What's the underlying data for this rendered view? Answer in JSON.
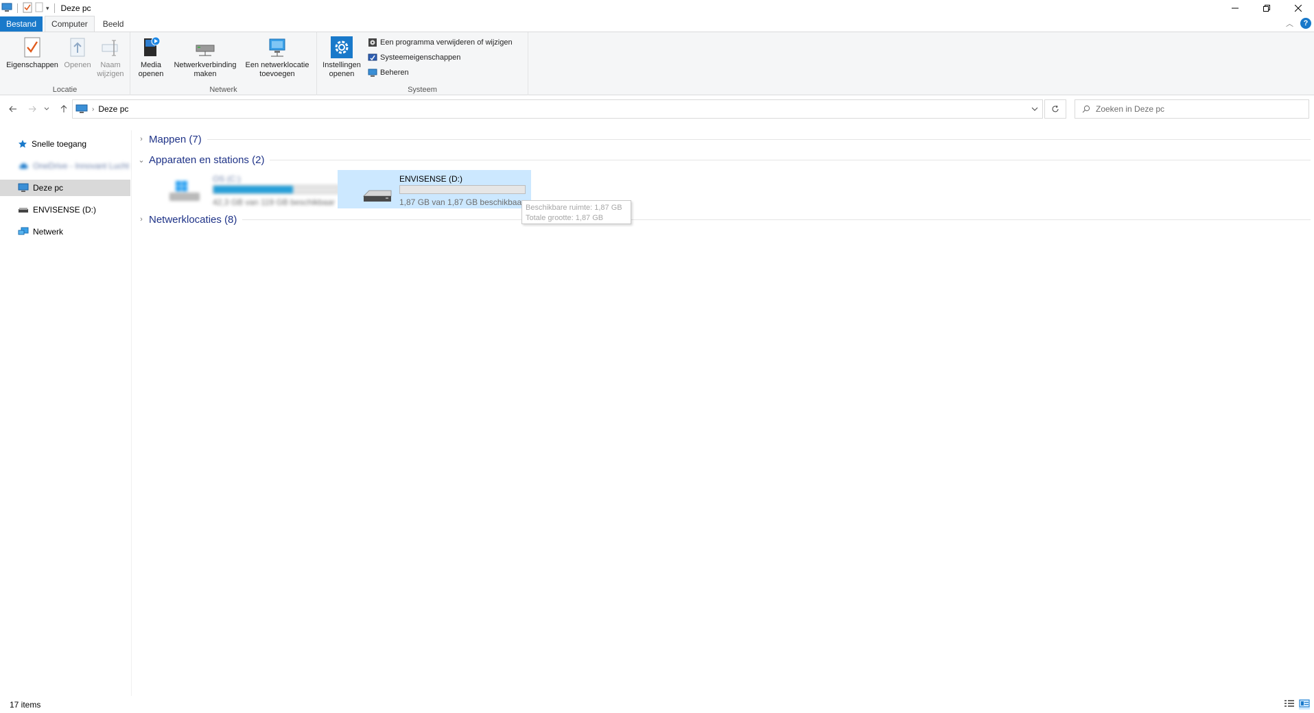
{
  "window": {
    "title": "Deze pc",
    "ribbon_tabs": [
      "Bestand",
      "Computer",
      "Beeld"
    ],
    "active_tab": "Computer"
  },
  "ribbon": {
    "groups": {
      "locatie": "Locatie",
      "netwerk": "Netwerk",
      "systeem": "Systeem"
    },
    "buttons": {
      "eigenschappen": "Eigenschappen",
      "openen": "Openen",
      "naam_line1": "Naam",
      "naam_line2": "wijzigen",
      "media_line1": "Media",
      "media_line2": "openen",
      "netwerkverbinding_line1": "Netwerkverbinding",
      "netwerkverbinding_line2": "maken",
      "netwerklocatie_line1": "Een netwerklocatie",
      "netwerklocatie_line2": "toevoegen",
      "instellingen_line1": "Instellingen",
      "instellingen_line2": "openen",
      "programma": "Een programma verwijderen of wijzigen",
      "systeemeigenschappen": "Systeemeigenschappen",
      "beheren": "Beheren"
    }
  },
  "address": {
    "crumb": "Deze pc",
    "search_placeholder": "Zoeken in Deze pc"
  },
  "navpane": {
    "items": [
      {
        "label": "Snelle toegang",
        "icon": "star-icon"
      },
      {
        "label": "OneDrive - Innovant Lucht",
        "icon": "cloud-icon"
      },
      {
        "label": "Deze pc",
        "icon": "computer-icon"
      },
      {
        "label": "ENVISENSE (D:)",
        "icon": "drive-icon"
      },
      {
        "label": "Netwerk",
        "icon": "network-icon"
      }
    ],
    "selected": "Deze pc"
  },
  "content": {
    "sections": {
      "mappen": "Mappen (7)",
      "apparaten": "Apparaten en stations (2)",
      "netwerklocaties": "Netwerklocaties (8)"
    },
    "drives": [
      {
        "name": "OS (C:)",
        "info": "42,3 GB van 119 GB beschikbaar",
        "used_fraction": 0.64
      },
      {
        "name": "ENVISENSE (D:)",
        "info": "1,87 GB van 1,87 GB beschikbaar",
        "used_fraction": 0.0
      }
    ],
    "tooltip": {
      "line1": "Beschikbare ruimte: 1,87 GB",
      "line2": "Totale grootte: 1,87 GB"
    }
  },
  "statusbar": {
    "items": "17 items"
  },
  "colors": {
    "accent": "#1979ca",
    "selection": "#cce8ff",
    "section_title": "#1e3287",
    "bar_fill": "#26a0da"
  }
}
